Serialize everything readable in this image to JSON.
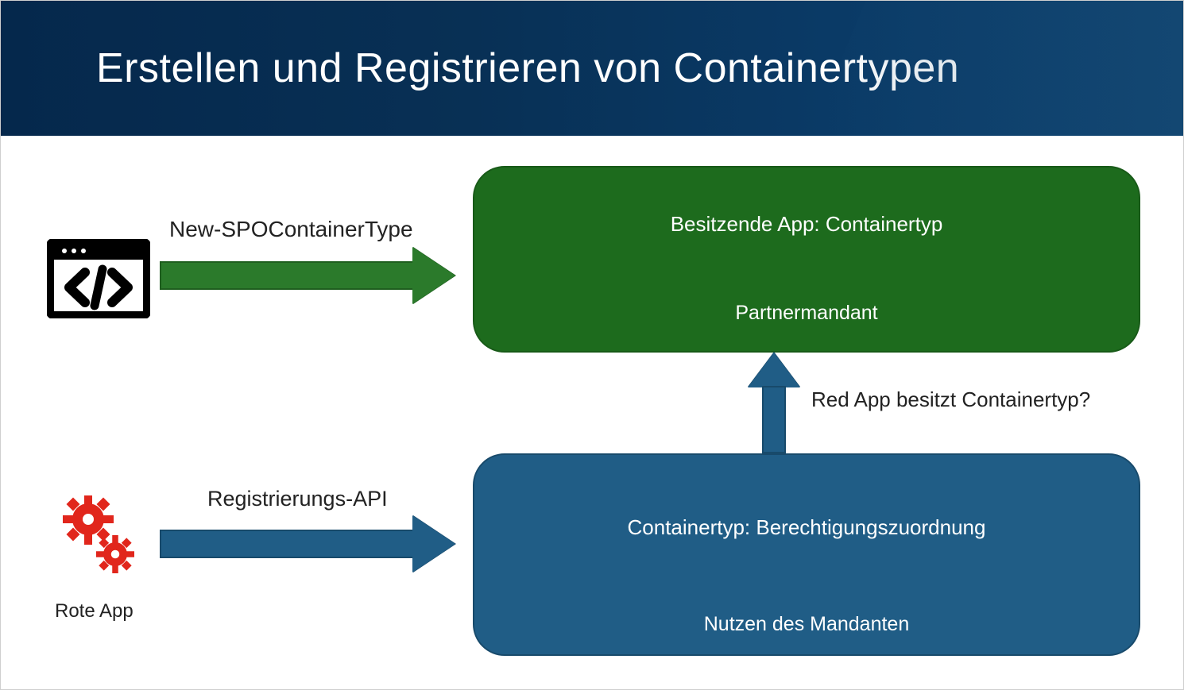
{
  "header": {
    "title": "Erstellen und Registrieren von Containertypen"
  },
  "arrows": {
    "new_container_label": "New-SPOContainerType",
    "registration_label": "Registrierungs-API",
    "red_question_label": "Red App besitzt Containertyp?"
  },
  "boxes": {
    "green": {
      "line1": "Besitzende App: Containertyp",
      "line2": "Partnermandant"
    },
    "blue": {
      "line1": "Containertyp: Berechtigungszuordnung",
      "line2": "Nutzen des Mandanten"
    }
  },
  "icons": {
    "code": "code-icon",
    "gears": "gears-icon"
  },
  "app_label": "Rote App",
  "colors": {
    "green_fill": "#1d6b1d",
    "blue_fill": "#205d86",
    "red_icon": "#e1261c",
    "header_bg": "#083055"
  }
}
